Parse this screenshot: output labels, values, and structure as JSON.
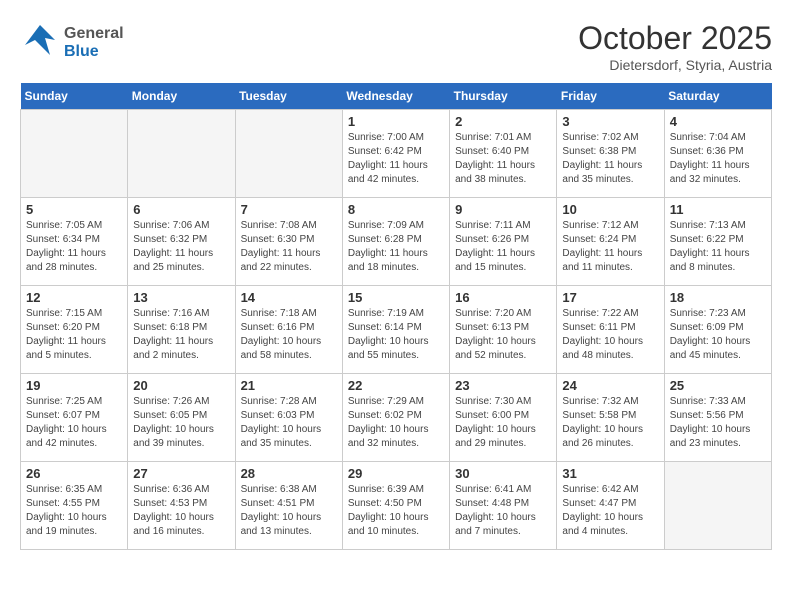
{
  "header": {
    "logo": {
      "general": "General",
      "blue": "Blue"
    },
    "month": "October 2025",
    "location": "Dietersdorf, Styria, Austria"
  },
  "weekdays": [
    "Sunday",
    "Monday",
    "Tuesday",
    "Wednesday",
    "Thursday",
    "Friday",
    "Saturday"
  ],
  "weeks": [
    [
      {
        "day": "",
        "info": ""
      },
      {
        "day": "",
        "info": ""
      },
      {
        "day": "",
        "info": ""
      },
      {
        "day": "1",
        "info": "Sunrise: 7:00 AM\nSunset: 6:42 PM\nDaylight: 11 hours\nand 42 minutes."
      },
      {
        "day": "2",
        "info": "Sunrise: 7:01 AM\nSunset: 6:40 PM\nDaylight: 11 hours\nand 38 minutes."
      },
      {
        "day": "3",
        "info": "Sunrise: 7:02 AM\nSunset: 6:38 PM\nDaylight: 11 hours\nand 35 minutes."
      },
      {
        "day": "4",
        "info": "Sunrise: 7:04 AM\nSunset: 6:36 PM\nDaylight: 11 hours\nand 32 minutes."
      }
    ],
    [
      {
        "day": "5",
        "info": "Sunrise: 7:05 AM\nSunset: 6:34 PM\nDaylight: 11 hours\nand 28 minutes."
      },
      {
        "day": "6",
        "info": "Sunrise: 7:06 AM\nSunset: 6:32 PM\nDaylight: 11 hours\nand 25 minutes."
      },
      {
        "day": "7",
        "info": "Sunrise: 7:08 AM\nSunset: 6:30 PM\nDaylight: 11 hours\nand 22 minutes."
      },
      {
        "day": "8",
        "info": "Sunrise: 7:09 AM\nSunset: 6:28 PM\nDaylight: 11 hours\nand 18 minutes."
      },
      {
        "day": "9",
        "info": "Sunrise: 7:11 AM\nSunset: 6:26 PM\nDaylight: 11 hours\nand 15 minutes."
      },
      {
        "day": "10",
        "info": "Sunrise: 7:12 AM\nSunset: 6:24 PM\nDaylight: 11 hours\nand 11 minutes."
      },
      {
        "day": "11",
        "info": "Sunrise: 7:13 AM\nSunset: 6:22 PM\nDaylight: 11 hours\nand 8 minutes."
      }
    ],
    [
      {
        "day": "12",
        "info": "Sunrise: 7:15 AM\nSunset: 6:20 PM\nDaylight: 11 hours\nand 5 minutes."
      },
      {
        "day": "13",
        "info": "Sunrise: 7:16 AM\nSunset: 6:18 PM\nDaylight: 11 hours\nand 2 minutes."
      },
      {
        "day": "14",
        "info": "Sunrise: 7:18 AM\nSunset: 6:16 PM\nDaylight: 10 hours\nand 58 minutes."
      },
      {
        "day": "15",
        "info": "Sunrise: 7:19 AM\nSunset: 6:14 PM\nDaylight: 10 hours\nand 55 minutes."
      },
      {
        "day": "16",
        "info": "Sunrise: 7:20 AM\nSunset: 6:13 PM\nDaylight: 10 hours\nand 52 minutes."
      },
      {
        "day": "17",
        "info": "Sunrise: 7:22 AM\nSunset: 6:11 PM\nDaylight: 10 hours\nand 48 minutes."
      },
      {
        "day": "18",
        "info": "Sunrise: 7:23 AM\nSunset: 6:09 PM\nDaylight: 10 hours\nand 45 minutes."
      }
    ],
    [
      {
        "day": "19",
        "info": "Sunrise: 7:25 AM\nSunset: 6:07 PM\nDaylight: 10 hours\nand 42 minutes."
      },
      {
        "day": "20",
        "info": "Sunrise: 7:26 AM\nSunset: 6:05 PM\nDaylight: 10 hours\nand 39 minutes."
      },
      {
        "day": "21",
        "info": "Sunrise: 7:28 AM\nSunset: 6:03 PM\nDaylight: 10 hours\nand 35 minutes."
      },
      {
        "day": "22",
        "info": "Sunrise: 7:29 AM\nSunset: 6:02 PM\nDaylight: 10 hours\nand 32 minutes."
      },
      {
        "day": "23",
        "info": "Sunrise: 7:30 AM\nSunset: 6:00 PM\nDaylight: 10 hours\nand 29 minutes."
      },
      {
        "day": "24",
        "info": "Sunrise: 7:32 AM\nSunset: 5:58 PM\nDaylight: 10 hours\nand 26 minutes."
      },
      {
        "day": "25",
        "info": "Sunrise: 7:33 AM\nSunset: 5:56 PM\nDaylight: 10 hours\nand 23 minutes."
      }
    ],
    [
      {
        "day": "26",
        "info": "Sunrise: 6:35 AM\nSunset: 4:55 PM\nDaylight: 10 hours\nand 19 minutes."
      },
      {
        "day": "27",
        "info": "Sunrise: 6:36 AM\nSunset: 4:53 PM\nDaylight: 10 hours\nand 16 minutes."
      },
      {
        "day": "28",
        "info": "Sunrise: 6:38 AM\nSunset: 4:51 PM\nDaylight: 10 hours\nand 13 minutes."
      },
      {
        "day": "29",
        "info": "Sunrise: 6:39 AM\nSunset: 4:50 PM\nDaylight: 10 hours\nand 10 minutes."
      },
      {
        "day": "30",
        "info": "Sunrise: 6:41 AM\nSunset: 4:48 PM\nDaylight: 10 hours\nand 7 minutes."
      },
      {
        "day": "31",
        "info": "Sunrise: 6:42 AM\nSunset: 4:47 PM\nDaylight: 10 hours\nand 4 minutes."
      },
      {
        "day": "",
        "info": ""
      }
    ]
  ]
}
